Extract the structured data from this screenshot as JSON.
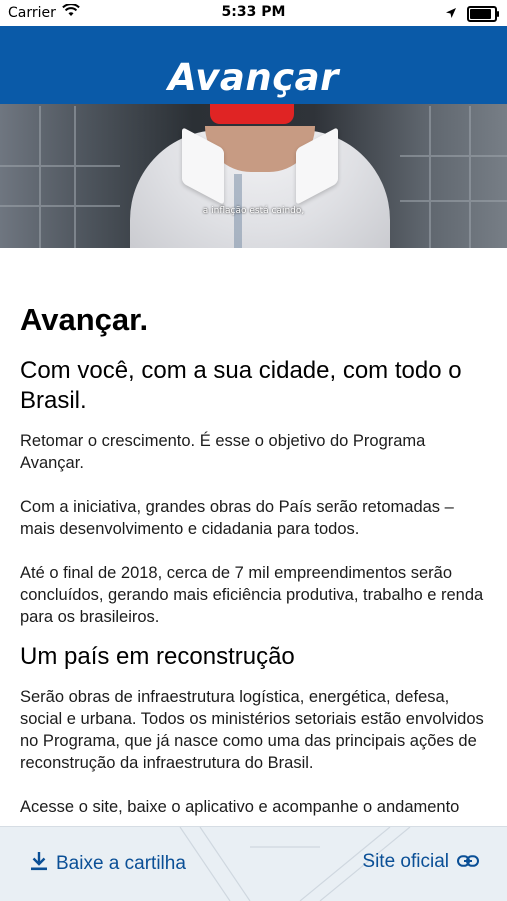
{
  "status_bar": {
    "carrier": "Carrier",
    "time": "5:33 PM",
    "icons": [
      "wifi-icon",
      "location-arrow-icon",
      "battery-icon"
    ]
  },
  "header": {
    "brand_title": "Avançar",
    "brand_color": "#0a5aa8"
  },
  "video": {
    "caption": "a inflação está caindo,"
  },
  "article": {
    "title": "Avançar.",
    "subtitle": "Com você, com a sua cidade, com todo o Brasil.",
    "p1": "Retomar o crescimento. É esse o objetivo do Programa Avançar.",
    "p2": "Com a iniciativa, grandes obras do País serão retomadas – mais desenvolvimento e cidadania para todos.",
    "p3": "Até o final de 2018, cerca de 7 mil empreendimentos serão concluídos, gerando mais eficiência produtiva, trabalho e renda para os brasileiros.",
    "section_title": "Um país em reconstrução",
    "p4": "Serão obras de infraestrutura logística, energética, defesa, social e urbana. Todos os ministérios setoriais estão envolvidos no Programa, que já nasce como uma das principais ações de reconstrução da infraestrutura do Brasil.",
    "p5": "Acesse o site, baixe o aplicativo e acompanhe o andamento"
  },
  "bottom_bar": {
    "download_label": "Baixe a cartilha",
    "site_label": "Site oficial",
    "accent_color": "#0a4f96"
  }
}
